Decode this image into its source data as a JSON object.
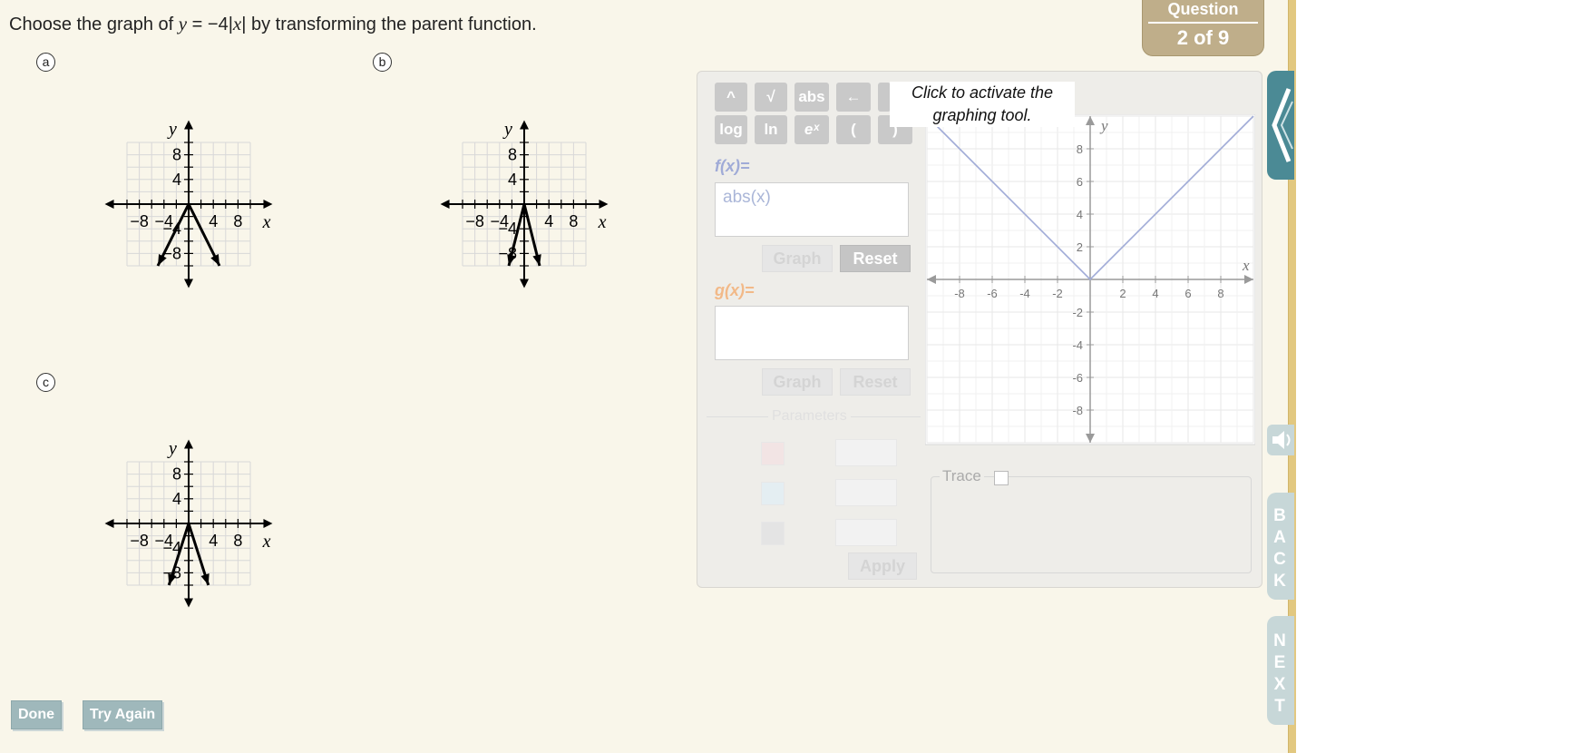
{
  "question": {
    "prefix": "Choose the graph of ",
    "var_y": "y",
    "equation": " = −4|",
    "var_x": "x",
    "suffix": "| by transforming the parent function."
  },
  "badge": {
    "label": "Question",
    "progress": "2 of 9"
  },
  "options": [
    {
      "id": "a",
      "label": "a",
      "chart_key": "a"
    },
    {
      "id": "b",
      "label": "b",
      "chart_key": "b"
    },
    {
      "id": "c",
      "label": "c",
      "chart_key": "c"
    }
  ],
  "chart_data": [
    {
      "type": "line",
      "option": "a",
      "xlabel": "x",
      "ylabel": "y",
      "xlim": [
        -12,
        12
      ],
      "ylim": [
        -12,
        12
      ],
      "xticks": [
        "−8",
        "−4",
        "4",
        "8"
      ],
      "yticks": [
        "8",
        "4",
        "−4",
        "−8"
      ],
      "series": [
        {
          "x": [
            -5,
            0,
            5
          ],
          "y": [
            -10,
            0,
            -10
          ]
        }
      ]
    },
    {
      "type": "line",
      "option": "b",
      "xlabel": "x",
      "ylabel": "y",
      "xlim": [
        -12,
        12
      ],
      "ylim": [
        -12,
        12
      ],
      "xticks": [
        "−8",
        "−4",
        "4",
        "8"
      ],
      "yticks": [
        "8",
        "4",
        "−4",
        "−8"
      ],
      "series": [
        {
          "x": [
            -2.5,
            0,
            2.5
          ],
          "y": [
            -10,
            0,
            -10
          ]
        }
      ]
    },
    {
      "type": "line",
      "option": "c",
      "xlabel": "x",
      "ylabel": "y",
      "xlim": [
        -12,
        12
      ],
      "ylim": [
        -12,
        12
      ],
      "xticks": [
        "−8",
        "−4",
        "4",
        "8"
      ],
      "yticks": [
        "8",
        "4",
        "−4",
        "−8"
      ],
      "series": [
        {
          "x": [
            -3.2,
            0,
            3.2
          ],
          "y": [
            -10,
            0,
            -10
          ]
        }
      ]
    },
    {
      "type": "line",
      "option": "tool",
      "xlabel": "x",
      "ylabel": "y",
      "xlim": [
        -10,
        10
      ],
      "ylim": [
        -10,
        10
      ],
      "xticks": [
        "-8",
        "-6",
        "-4",
        "-2",
        "2",
        "4",
        "6",
        "8"
      ],
      "yticks": [
        "8",
        "6",
        "4",
        "2",
        "-2",
        "-4",
        "-6",
        "-8"
      ],
      "series": [
        {
          "x": [
            -10,
            0,
            10
          ],
          "y": [
            10,
            0,
            10
          ]
        }
      ]
    }
  ],
  "keypad": {
    "row1": [
      "^",
      "√",
      "abs",
      "←"
    ],
    "row2": [
      "log",
      "ln",
      "eˣ",
      "(",
      ")"
    ]
  },
  "tool": {
    "tooltip": "Click to activate the graphing tool.",
    "f_label": "f(x)=",
    "f_value": "abs(x)",
    "g_label": "g(x)=",
    "g_value": "",
    "graph_label": "Graph",
    "reset_label": "Reset",
    "parameters_label": "Parameters",
    "apply_label": "Apply",
    "trace_label": "Trace"
  },
  "colors": {
    "f": "#a0abd7",
    "g": "#f2b988",
    "panel": "#eeede9",
    "badge": "#bfae8a",
    "nav": "#c7d7d8"
  },
  "nav": {
    "back": [
      "B",
      "A",
      "C",
      "K"
    ],
    "next": [
      "N",
      "E",
      "X",
      "T"
    ],
    "audio_icon": "speaker-icon",
    "collapse_icon": "chevron-left-icon"
  },
  "footer": {
    "done": "Done",
    "try_again": "Try Again"
  }
}
